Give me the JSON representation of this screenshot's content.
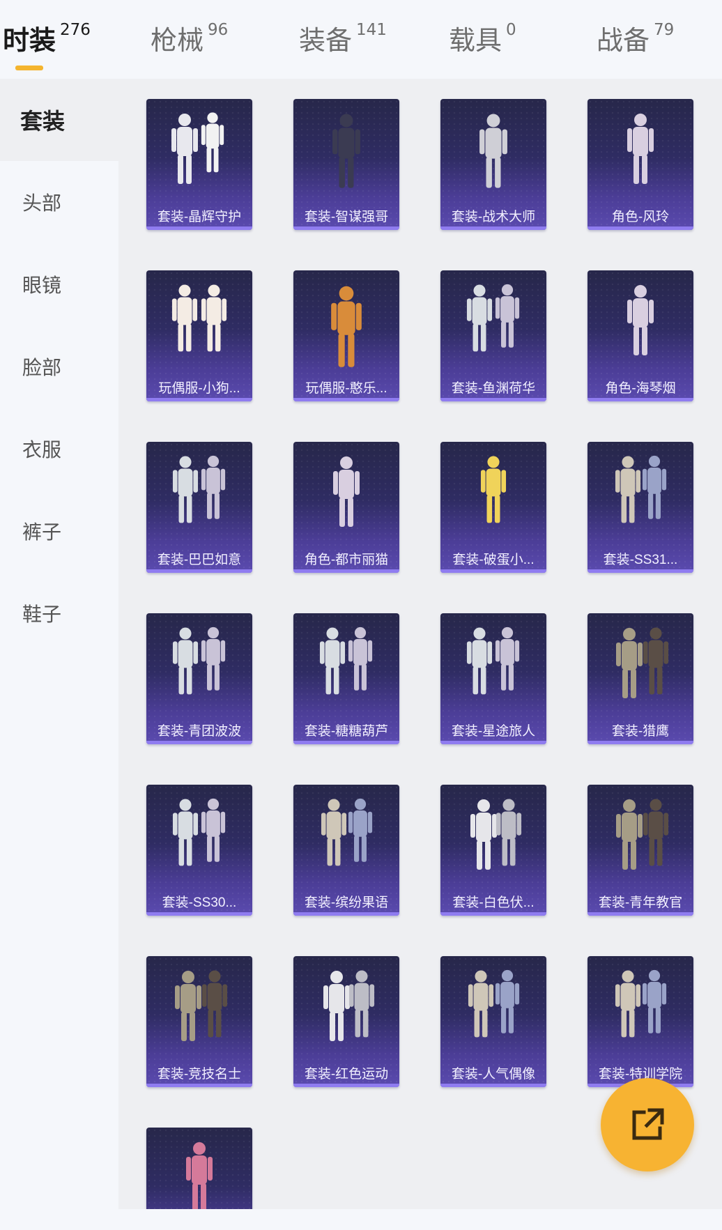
{
  "tabs": [
    {
      "label": "时装",
      "count": "276",
      "active": true
    },
    {
      "label": "枪械",
      "count": "96",
      "active": false
    },
    {
      "label": "装备",
      "count": "141",
      "active": false
    },
    {
      "label": "载具",
      "count": "0",
      "active": false
    },
    {
      "label": "战备",
      "count": "79",
      "active": false
    }
  ],
  "sidebar": {
    "items": [
      {
        "label": "套装",
        "active": true
      },
      {
        "label": "头部",
        "active": false
      },
      {
        "label": "眼镜",
        "active": false
      },
      {
        "label": "脸部",
        "active": false
      },
      {
        "label": "衣服",
        "active": false
      },
      {
        "label": "裤子",
        "active": false
      },
      {
        "label": "鞋子",
        "active": false
      }
    ]
  },
  "items": [
    {
      "label": "套装-晶辉守护",
      "icon": "white-couple-outfit-icon"
    },
    {
      "label": "套装-智谋强哥",
      "icon": "man-suit-outfit-icon"
    },
    {
      "label": "套装-战术大师",
      "icon": "tactical-outfit-icon"
    },
    {
      "label": "角色-风玲",
      "icon": "female-character-icon"
    },
    {
      "label": "玩偶服-小狗...",
      "icon": "dog-costume-icon"
    },
    {
      "label": "玩偶服-憨乐...",
      "icon": "bear-costume-icon"
    },
    {
      "label": "套装-鱼渊荷华",
      "icon": "couple-outfit-icon"
    },
    {
      "label": "角色-海琴烟",
      "icon": "female-character-icon"
    },
    {
      "label": "套装-巴巴如意",
      "icon": "couple-outfit-icon"
    },
    {
      "label": "角色-都市丽猫",
      "icon": "female-character-icon"
    },
    {
      "label": "套装-破蛋小...",
      "icon": "chick-costume-icon"
    },
    {
      "label": "套装-SS31...",
      "icon": "outfit-set-icon"
    },
    {
      "label": "套装-青团波波",
      "icon": "couple-outfit-icon"
    },
    {
      "label": "套装-糖糖葫芦",
      "icon": "couple-outfit-icon"
    },
    {
      "label": "套装-星途旅人",
      "icon": "couple-outfit-icon"
    },
    {
      "label": "套装-猎鹰",
      "icon": "jacket-pants-icon"
    },
    {
      "label": "套装-SS30...",
      "icon": "couple-outfit-icon"
    },
    {
      "label": "套装-缤纷果语",
      "icon": "outfit-set-icon"
    },
    {
      "label": "套装-白色伏...",
      "icon": "hoodie-pants-icon"
    },
    {
      "label": "套装-青年教官",
      "icon": "jacket-pants-icon"
    },
    {
      "label": "套装-竞技名士",
      "icon": "jacket-pants-icon"
    },
    {
      "label": "套装-红色运动",
      "icon": "hoodie-pants-icon"
    },
    {
      "label": "套装-人气偶像",
      "icon": "outfit-set-icon"
    },
    {
      "label": "套装-特训学院",
      "icon": "outfit-set-icon"
    },
    {
      "label": "",
      "icon": "pink-character-icon"
    }
  ],
  "fab": {
    "icon": "share-icon"
  },
  "colors": {
    "accent": "#f4b42e",
    "card_top": "#27274a",
    "card_bottom": "#5b4bb0",
    "card_bar": "#8f7cf0",
    "fab": "#f7b332"
  }
}
